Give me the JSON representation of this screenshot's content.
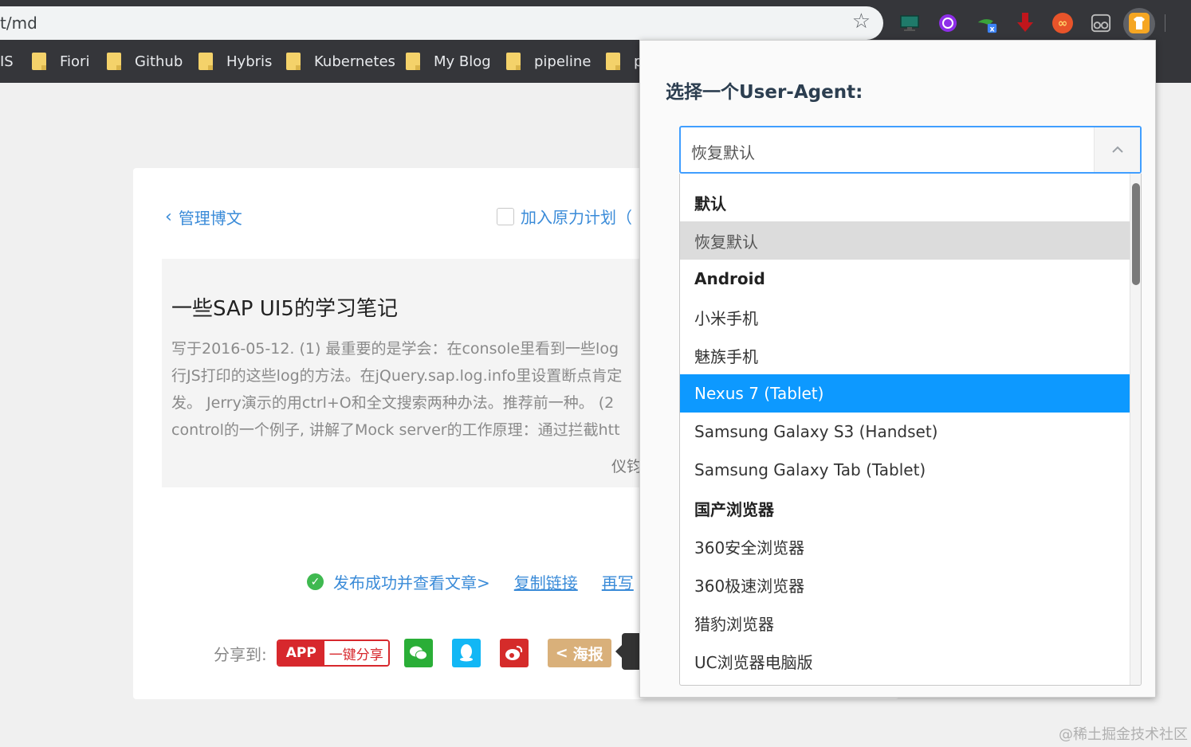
{
  "browser": {
    "url_fragment": "t/md",
    "bookmarks": [
      {
        "label": "IS"
      },
      {
        "label": "Fiori"
      },
      {
        "label": "Github"
      },
      {
        "label": "Hybris"
      },
      {
        "label": "Kubernetes"
      },
      {
        "label": "My Blog"
      },
      {
        "label": "pipeline"
      },
      {
        "label": "p"
      }
    ],
    "extensions": [
      {
        "name": "monitor-extension-icon"
      },
      {
        "name": "purple-circle-extension-icon"
      },
      {
        "name": "green-x-extension-icon",
        "badge": "x"
      },
      {
        "name": "red-arrow-extension-icon"
      },
      {
        "name": "infinity-extension-icon",
        "glyph": "∞"
      },
      {
        "name": "glasses-extension-icon"
      },
      {
        "name": "user-agent-switcher-extension-icon"
      }
    ]
  },
  "editor": {
    "back_label": "管理博文",
    "yuanli_label": "加入原力计划（",
    "article": {
      "title": "一些SAP UI5的学习笔记",
      "lines": [
        "写于2016-05-12. (1) 最重要的是学会：在console里看到一些log",
        "行JS打印的这些log的方法。在jQuery.sap.log.info里设置断点肯定",
        "发。 Jerry演示的用ctrl+O和全文搜索两种办法。推荐前一种。 (2",
        "control的一个例子, 讲解了Mock server的工作原理：通过拦截htt"
      ],
      "author": "仪钧"
    },
    "publish": {
      "view_label": "发布成功并查看文章>",
      "copy_label": "复制链接",
      "again_label": "再写"
    },
    "share": {
      "label": "分享到:",
      "app_tag": "APP",
      "app_text": "一键分享",
      "poster_label": "海报"
    }
  },
  "popup": {
    "title": "选择一个User-Agent:",
    "selected_value": "恢复默认",
    "options": [
      {
        "label": "默认",
        "kind": "group"
      },
      {
        "label": "恢复默认",
        "kind": "hover"
      },
      {
        "label": "Android",
        "kind": "group"
      },
      {
        "label": "小米手机",
        "kind": "option"
      },
      {
        "label": "魅族手机",
        "kind": "option"
      },
      {
        "label": "Nexus 7 (Tablet)",
        "kind": "selected"
      },
      {
        "label": "Samsung Galaxy S3 (Handset)",
        "kind": "option"
      },
      {
        "label": "Samsung Galaxy Tab (Tablet)",
        "kind": "option"
      },
      {
        "label": "国产浏览器",
        "kind": "group"
      },
      {
        "label": "360安全浏览器",
        "kind": "option"
      },
      {
        "label": "360极速浏览器",
        "kind": "option"
      },
      {
        "label": "猎豹浏览器",
        "kind": "option"
      },
      {
        "label": "UC浏览器电脑版",
        "kind": "option"
      }
    ]
  },
  "watermark": "@稀土掘金技术社区",
  "colors": {
    "accent": "#3a8bd8",
    "selected": "#0d99ff",
    "focus_border": "#409eff",
    "share_red": "#d7282d",
    "wechat": "#2aae37",
    "qq": "#12b7f5",
    "weibo": "#d52b2a",
    "poster": "#d9b07a"
  }
}
